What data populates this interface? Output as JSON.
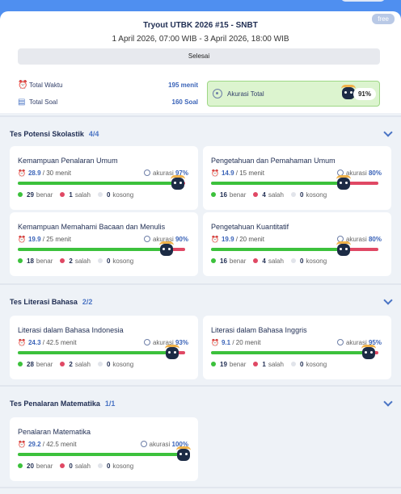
{
  "header": {
    "free_badge": "free",
    "title": "Tryout UTBK 2026 #15 - SNBT",
    "date_range": "1 April 2026, 07:00 WIB - 3 April 2026, 18:00 WIB",
    "status": "Selesai",
    "total_waktu_label": "Total Waktu",
    "total_waktu_value": "195 menit",
    "total_soal_label": "Total Soal",
    "total_soal_value": "160 Soal",
    "akurasi_total_label": "Akurasi Total",
    "akurasi_total_value": "91%"
  },
  "labels": {
    "benar": "benar",
    "salah": "salah",
    "kosong": "kosong",
    "akurasi": "akurasi"
  },
  "sections": [
    {
      "title": "Tes Potensi Skolastik",
      "count": "4/4",
      "cards": [
        {
          "title": "Kemampuan Penalaran Umum",
          "time_used": "28.9",
          "time_total": "/ 30 menit",
          "accuracy": "97%",
          "accuracy_fraction": 0.97,
          "benar": "29",
          "salah": "1",
          "kosong": "0",
          "benar_n": 29,
          "salah_n": 1,
          "kosong_n": 0
        },
        {
          "title": "Pengetahuan dan Pemahaman Umum",
          "time_used": "14.9",
          "time_total": "/ 15 menit",
          "accuracy": "80%",
          "accuracy_fraction": 0.8,
          "benar": "16",
          "salah": "4",
          "kosong": "0",
          "benar_n": 16,
          "salah_n": 4,
          "kosong_n": 0
        },
        {
          "title": "Kemampuan Memahami Bacaan dan Menulis",
          "time_used": "19.9",
          "time_total": "/ 25 menit",
          "accuracy": "90%",
          "accuracy_fraction": 0.9,
          "benar": "18",
          "salah": "2",
          "kosong": "0",
          "benar_n": 18,
          "salah_n": 2,
          "kosong_n": 0
        },
        {
          "title": "Pengetahuan Kuantitatif",
          "time_used": "19.9",
          "time_total": "/ 20 menit",
          "accuracy": "80%",
          "accuracy_fraction": 0.8,
          "benar": "16",
          "salah": "4",
          "kosong": "0",
          "benar_n": 16,
          "salah_n": 4,
          "kosong_n": 0
        }
      ]
    },
    {
      "title": "Tes Literasi Bahasa",
      "count": "2/2",
      "cards": [
        {
          "title": "Literasi dalam Bahasa Indonesia",
          "time_used": "24.3",
          "time_total": "/ 42.5 menit",
          "accuracy": "93%",
          "accuracy_fraction": 0.93,
          "benar": "28",
          "salah": "2",
          "kosong": "0",
          "benar_n": 28,
          "salah_n": 2,
          "kosong_n": 0
        },
        {
          "title": "Literasi dalam Bahasa Inggris",
          "time_used": "9.1",
          "time_total": "/ 20 menit",
          "accuracy": "95%",
          "accuracy_fraction": 0.95,
          "benar": "19",
          "salah": "1",
          "kosong": "0",
          "benar_n": 19,
          "salah_n": 1,
          "kosong_n": 0
        }
      ]
    },
    {
      "title": "Tes Penalaran Matematika",
      "count": "1/1",
      "cards": [
        {
          "title": "Penalaran Matematika",
          "time_used": "29.2",
          "time_total": "/ 42.5 menit",
          "accuracy": "100%",
          "accuracy_fraction": 1.0,
          "benar": "20",
          "salah": "0",
          "kosong": "0",
          "benar_n": 20,
          "salah_n": 0,
          "kosong_n": 0
        }
      ]
    }
  ],
  "colors": {
    "benar": "#3cc13c",
    "salah": "#e04864",
    "kosong": "#e1e4ea",
    "accent": "#4f8ff0"
  },
  "icons": {
    "time": "alarm-clock-icon",
    "soal": "document-icon",
    "akurasi": "target-icon",
    "section_toggle": "chevron-down-icon",
    "mascot": "cat-mascot-icon"
  }
}
